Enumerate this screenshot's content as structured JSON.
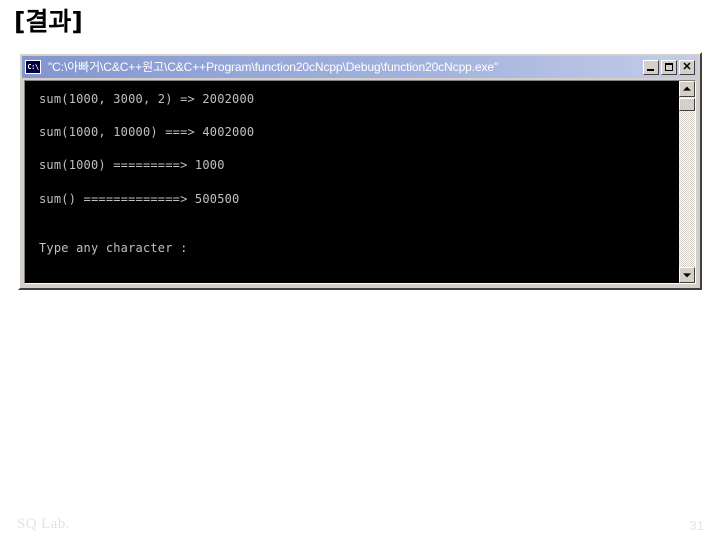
{
  "slide": {
    "heading": "[결과]",
    "footer_label": "SQ Lab.",
    "page_number": "31",
    "background_color": "#ffffff",
    "footer_color": "#dce6e8"
  },
  "console_window": {
    "title": "\"C:\\아빠거\\C&C++원고\\C&C++Program\\function20cNcpp\\Debug\\function20cNcpp.exe\"",
    "icon": "cmd-icon",
    "icon_glyph": "C:\\",
    "titlebar_color_left": "#8296ce",
    "titlebar_color_right": "#c3cce9",
    "titlebar_text_color": "#ffffff",
    "window_chrome_color": "#d4d0c8",
    "buttons": [
      {
        "name": "minimize",
        "label": "_",
        "tooltip": "Minimize"
      },
      {
        "name": "maximize",
        "label": "□",
        "tooltip": "Maximize"
      },
      {
        "name": "close",
        "label": "✕",
        "tooltip": "Close"
      }
    ],
    "client": {
      "background_color": "#000000",
      "text_color": "#c0c0c0",
      "lines": [
        "sum(1000, 3000, 2) => 2002000",
        "",
        "sum(1000, 10000) ===> 4002000",
        "",
        "sum(1000) =========> 1000",
        "",
        "sum() =============> 500500",
        "",
        "",
        "Type any character : "
      ]
    },
    "scrollbar": {
      "orientation": "vertical",
      "up_arrow": "▲",
      "down_arrow": "▼",
      "thumb_position": "top"
    }
  }
}
